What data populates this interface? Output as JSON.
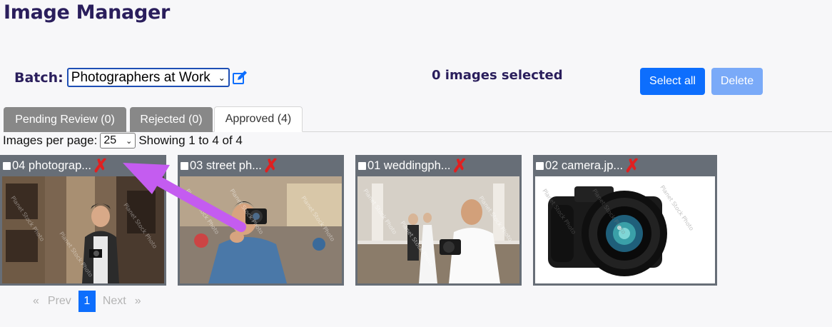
{
  "header": {
    "title": "Image Manager"
  },
  "batch": {
    "label": "Batch:",
    "selected": "Photographers at Work"
  },
  "selection": {
    "count_text": "0 images selected"
  },
  "actions": {
    "select_all": "Select all",
    "delete": "Delete"
  },
  "tabs": [
    {
      "label": "Pending Review (0)"
    },
    {
      "label": "Rejected (0)"
    },
    {
      "label": "Approved (4)"
    }
  ],
  "pager": {
    "per_page_label": "Images per page:",
    "per_page_value": "25",
    "showing": "Showing 1 to 4 of 4",
    "prev": "Prev",
    "current": "1",
    "next": "Next",
    "prev_marker": "«",
    "next_marker": "»"
  },
  "images": [
    {
      "name": "04 photograp...",
      "watermark": "Planet Stock Photo"
    },
    {
      "name": "03 street ph...",
      "watermark": "Planet Stock Photo"
    },
    {
      "name": "01 weddingph...",
      "watermark": "Planet Stock Photo"
    },
    {
      "name": "02 camera.jp...",
      "watermark": "Planet Stock Photo"
    }
  ],
  "colors": {
    "title": "#2a1e5c",
    "primary": "#0d6efd",
    "primary_disabled": "#7aaaf8",
    "card_bg": "#676e77",
    "remove_icon": "#e02020",
    "annotation_arrow": "#c45cf0"
  }
}
